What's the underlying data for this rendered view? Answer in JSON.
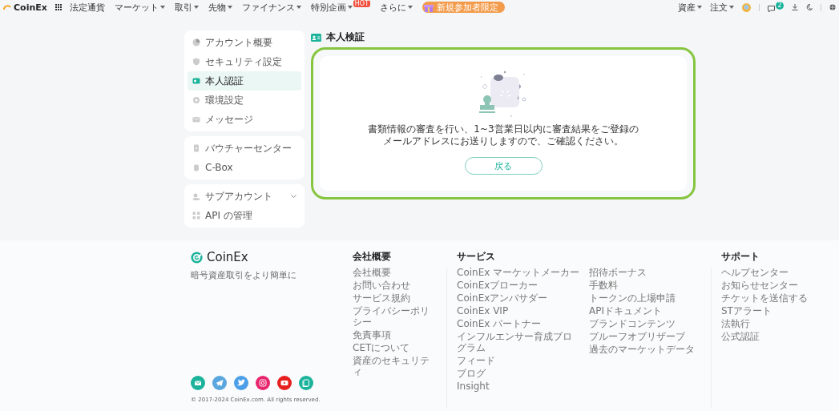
{
  "header": {
    "logo": "CoinEx",
    "nav": [
      {
        "label": "法定通貨",
        "kind": "link"
      },
      {
        "label": "マーケット",
        "kind": "dropdown"
      },
      {
        "label": "取引",
        "kind": "dropdown"
      },
      {
        "label": "先物",
        "kind": "dropdown"
      },
      {
        "label": "ファイナンス",
        "kind": "dropdown"
      },
      {
        "label": "特別企画",
        "kind": "dropdown",
        "badge": "HOT"
      },
      {
        "label": "さらに",
        "kind": "dropdown"
      }
    ],
    "promo": "新規参加者限定",
    "right_menu": [
      {
        "label": "資産"
      },
      {
        "label": "注文"
      }
    ],
    "notification_count": "2"
  },
  "sidebar": {
    "groups": [
      {
        "items": [
          {
            "label": "アカウント概要",
            "selected": false,
            "kind": "link"
          },
          {
            "label": "セキュリティ設定",
            "selected": false,
            "kind": "link"
          },
          {
            "label": "本人認証",
            "selected": true,
            "kind": "link"
          },
          {
            "label": "環境設定",
            "selected": false,
            "kind": "link"
          },
          {
            "label": "メッセージ",
            "selected": false,
            "kind": "link"
          }
        ]
      },
      {
        "items": [
          {
            "label": "バウチャーセンター",
            "selected": false,
            "kind": "link"
          },
          {
            "label": "C-Box",
            "selected": false,
            "kind": "link"
          }
        ]
      },
      {
        "items": [
          {
            "label": "サブアカウント",
            "selected": false,
            "kind": "expandable"
          },
          {
            "label": "API の管理",
            "selected": false,
            "kind": "link"
          }
        ]
      }
    ]
  },
  "page_title": "本人検証",
  "verification": {
    "message_lines": [
      "書類情報の審査を行い、1~3営業日以内に審査結果をご登録の",
      "メールアドレスにお送りしますので、ご確認ください。"
    ],
    "button": "戻る"
  },
  "footer": {
    "logo": "CoinEx",
    "tagline": "暗号資産取引をより簡単に",
    "columns": [
      {
        "title": "会社概要",
        "lists": [
          [
            "会社概要",
            "お問い合わせ",
            "サービス規約",
            "プライバシーポリシー",
            "免責事項",
            "CETについて",
            "資産のセキュリティ"
          ]
        ]
      },
      {
        "title": "サービス",
        "lists": [
          [
            "CoinEx マーケットメーカー",
            "CoinExブローカー",
            "CoinExアンバサダー",
            "CoinEx VIP",
            "CoinEx パートナー",
            "インフルエンサー育成プログラム",
            "フィード",
            "ブログ",
            "Insight"
          ],
          [
            "招待ボーナス",
            "手数料",
            "トークンの上場申請",
            "APIドキュメント",
            "ブランドコンテンツ",
            "プルーフオブリザーブ",
            "過去のマーケットデータ"
          ]
        ]
      },
      {
        "title": "サポート",
        "lists": [
          [
            "ヘルプセンター",
            "お知らせセンター",
            "チケットを送信する",
            "STアラート",
            "法執行",
            "公式認証"
          ]
        ]
      }
    ],
    "copyright": "© 2017-2024 CoinEx.com. All rights reserved."
  }
}
